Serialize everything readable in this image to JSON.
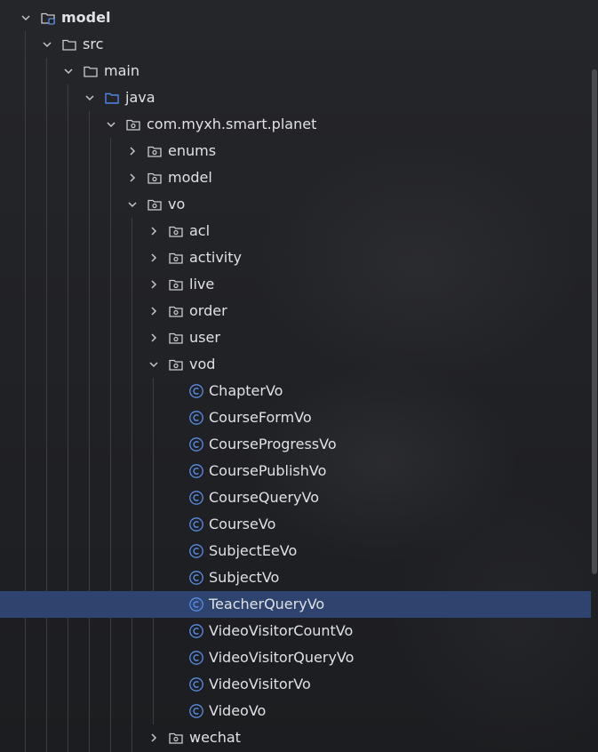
{
  "tree": {
    "root": {
      "label": "model",
      "icon": "module-folder-icon"
    },
    "src": {
      "label": "src",
      "icon": "folder-icon"
    },
    "main": {
      "label": "main",
      "icon": "folder-icon"
    },
    "java": {
      "label": "java",
      "icon": "source-root-folder-icon"
    },
    "pkg": {
      "label": "com.myxh.smart.planet",
      "icon": "package-icon"
    },
    "enums": {
      "label": "enums",
      "icon": "package-icon"
    },
    "model_pkg": {
      "label": "model",
      "icon": "package-icon"
    },
    "vo": {
      "label": "vo",
      "icon": "package-icon"
    },
    "acl": {
      "label": "acl",
      "icon": "package-icon"
    },
    "activity": {
      "label": "activity",
      "icon": "package-icon"
    },
    "live": {
      "label": "live",
      "icon": "package-icon"
    },
    "order": {
      "label": "order",
      "icon": "package-icon"
    },
    "user": {
      "label": "user",
      "icon": "package-icon"
    },
    "vod": {
      "label": "vod",
      "icon": "package-icon"
    },
    "classes": [
      {
        "label": "ChapterVo",
        "icon": "class-icon"
      },
      {
        "label": "CourseFormVo",
        "icon": "class-icon"
      },
      {
        "label": "CourseProgressVo",
        "icon": "class-icon"
      },
      {
        "label": "CoursePublishVo",
        "icon": "class-icon"
      },
      {
        "label": "CourseQueryVo",
        "icon": "class-icon"
      },
      {
        "label": "CourseVo",
        "icon": "class-icon"
      },
      {
        "label": "SubjectEeVo",
        "icon": "class-icon"
      },
      {
        "label": "SubjectVo",
        "icon": "class-icon"
      },
      {
        "label": "TeacherQueryVo",
        "icon": "class-icon"
      },
      {
        "label": "VideoVisitorCountVo",
        "icon": "class-icon"
      },
      {
        "label": "VideoVisitorQueryVo",
        "icon": "class-icon"
      },
      {
        "label": "VideoVisitorVo",
        "icon": "class-icon"
      },
      {
        "label": "VideoVo",
        "icon": "class-icon"
      }
    ],
    "wechat": {
      "label": "wechat",
      "icon": "package-icon"
    },
    "selected_class": "TeacherQueryVo"
  },
  "colors": {
    "background": "#1f2023",
    "selection": "#2e436e",
    "text": "#dfe1e5",
    "class_icon": "#5a8ee6",
    "source_root": "#4f86e8",
    "icon_stroke": "#c9ccd1"
  }
}
